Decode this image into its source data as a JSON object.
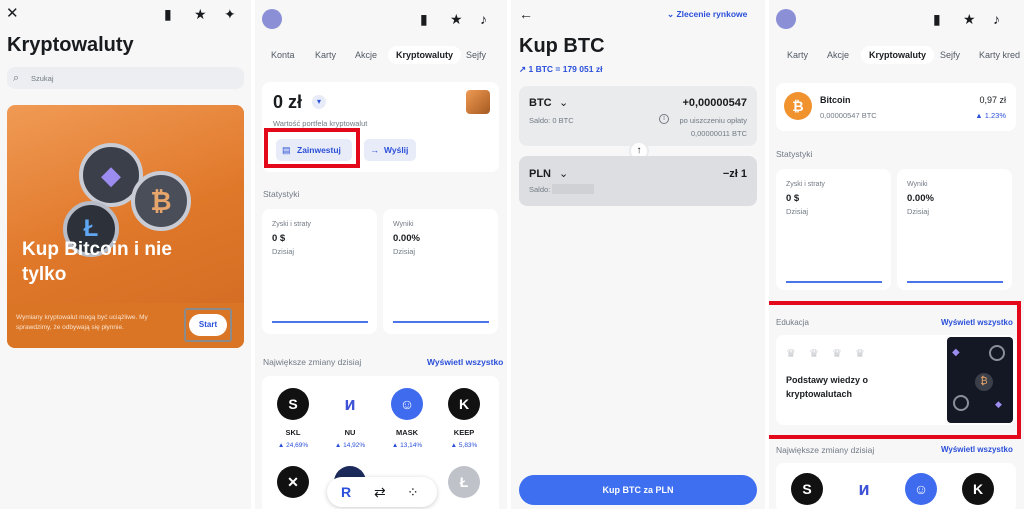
{
  "p1": {
    "title": "Kryptowaluty",
    "search_placeholder": "Szukaj",
    "hero_text": "Kup Bitcoin i nie tylko",
    "disclaimer": "Wymiany kryptowalut mogą być uciążliwe. My sprawdzimy, że odbywają się płynnie.",
    "start_label": "Start"
  },
  "p2": {
    "tabs": [
      "Konta",
      "Karty",
      "Akcje",
      "Kryptowaluty",
      "Sejfy"
    ],
    "balance": "0 zł",
    "balance_caption": "Wartość portfela kryptowalut",
    "invest_label": "Zainwestuj",
    "send_label": "Wyślij",
    "stats_title": "Statystyki",
    "stat1_label": "Zyski i straty",
    "stat1_value": "0 $",
    "stat1_period": "Dzisiaj",
    "stat2_label": "Wyniki",
    "stat2_value": "0.00%",
    "stat2_period": "Dzisiaj",
    "movers_title": "Największe zmiany dzisiaj",
    "see_all": "Wyświetl wszystko",
    "coins": [
      {
        "symbol": "SKL",
        "change": "▲ 24,69%"
      },
      {
        "symbol": "NU",
        "change": "▲ 14,92%"
      },
      {
        "symbol": "MASK",
        "change": "▲ 13,14%"
      },
      {
        "symbol": "KEEP",
        "change": "▲ 5,83%"
      }
    ]
  },
  "p3": {
    "order_type": "Zlecenie rynkowe",
    "title": "Kup BTC",
    "rate": "1 BTC = 179 051 zł",
    "from_currency": "BTC",
    "from_amount": "+0,00000547",
    "from_balance": "Saldo: 0 BTC",
    "fee_note": "po uiszczeniu opłaty",
    "fee_amount": "0,00000011 BTC",
    "to_currency": "PLN",
    "to_amount": "−zł 1",
    "to_balance": "Saldo:",
    "cta": "Kup BTC za PLN"
  },
  "p4": {
    "tabs": [
      "Karty",
      "Akcje",
      "Kryptowaluty",
      "Sejfy",
      "Karty kred"
    ],
    "asset_name": "Bitcoin",
    "asset_amount": "0,00000547 BTC",
    "asset_value": "0,97 zł",
    "asset_change": "▲ 1.23%",
    "stats_title": "Statystyki",
    "stat1_label": "Zyski i straty",
    "stat1_value": "0 $",
    "stat1_period": "Dzisiaj",
    "stat2_label": "Wyniki",
    "stat2_value": "0.00%",
    "stat2_period": "Dzisiaj",
    "edu_title": "Edukacja",
    "edu_see_all": "Wyświetl wszystko",
    "edu_card_title": "Podstawy wiedzy o kryptowalutach",
    "movers_title": "Największe zmiany dzisiaj",
    "movers_see_all": "Wyświetl wszystko"
  },
  "colors": {
    "accent": "#2a4fd8",
    "highlight": "#e4081b",
    "hero": "#e0782a",
    "positive": "#2a4fd8"
  }
}
